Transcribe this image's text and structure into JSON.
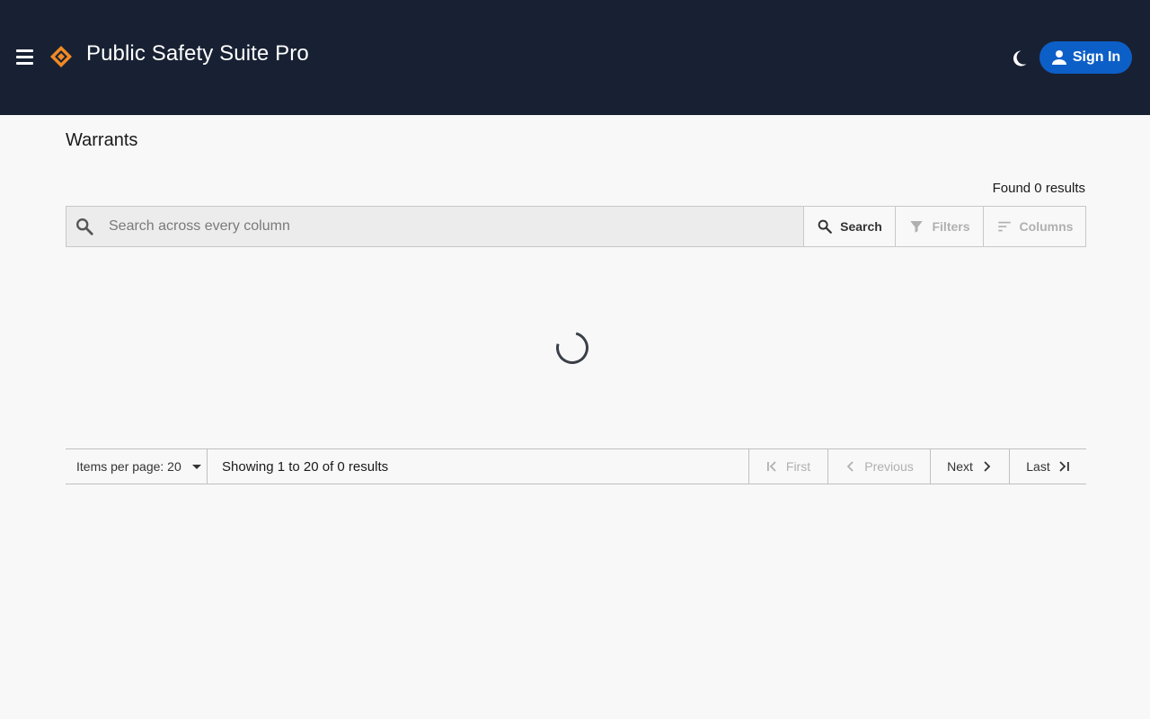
{
  "header": {
    "app_title": "Public Safety Suite Pro",
    "signin_label": "Sign In",
    "accent": "#0d5fc8",
    "bg": "#182133",
    "logo_color": "#f08a24"
  },
  "page": {
    "title": "Warrants",
    "found_text": "Found 0 results"
  },
  "search": {
    "placeholder": "Search across every column",
    "value": "",
    "search_label": "Search",
    "filters_label": "Filters",
    "columns_label": "Columns"
  },
  "pager": {
    "items_per_page_label": "Items per page: 20",
    "showing_text": "Showing 1 to 20 of 0 results",
    "first_label": "First",
    "prev_label": "Previous",
    "next_label": "Next",
    "last_label": "Last"
  },
  "icons": {
    "menu": "menu-icon",
    "logo": "logo-icon",
    "theme": "moon-icon",
    "user": "user-icon",
    "search": "search-icon",
    "filter": "filter-icon",
    "columns": "sort-lines-icon",
    "first": "first-page-icon",
    "prev": "chevron-left-icon",
    "next": "chevron-right-icon",
    "last": "last-page-icon"
  }
}
